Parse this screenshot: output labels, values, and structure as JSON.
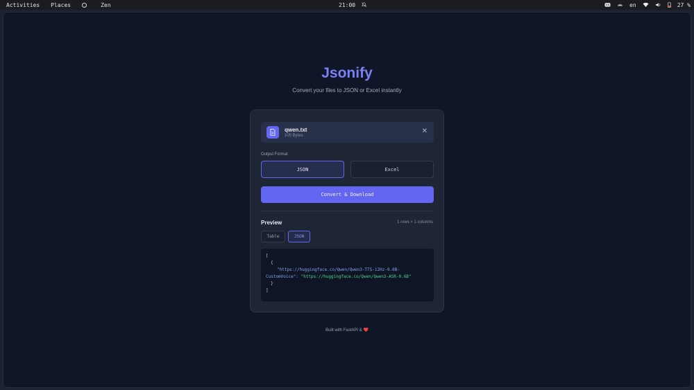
{
  "topbar": {
    "activities": "Activities",
    "places": "Places",
    "app": "Zen",
    "time": "21:00",
    "lang": "en",
    "battery": "27 %"
  },
  "app": {
    "title": "Jsonify",
    "subtitle": "Convert your files to JSON or Excel instantly"
  },
  "file": {
    "name": "qwen.txt",
    "size": "105 Bytes",
    "remove_icon": "close-icon"
  },
  "format": {
    "label": "Output Format",
    "options": [
      "JSON",
      "Excel"
    ],
    "selected": "JSON"
  },
  "convert_label": "Convert & Download",
  "preview": {
    "title": "Preview",
    "dims": "1 rows × 1 columns",
    "tabs": [
      "Table",
      "JSON"
    ],
    "active_tab": "JSON",
    "code": {
      "open_bracket": "[",
      "open_brace": "{",
      "key_line1": "\"https://huggingface.co/Qwen/Qwen3-TTS-12Hz-0.6B-",
      "key_line2": "CustomVoice\":",
      "value": "\"https://huggingface.co/Qwen/Qwen3-ASR-0.6B\"",
      "close_brace": "}",
      "close_bracket": "]"
    }
  },
  "footer": {
    "text": "Built with FastAPI & ",
    "heart": "❤️"
  },
  "colors": {
    "accent": "#6366f1",
    "background": "#0f1628",
    "card": "#1e2535"
  }
}
